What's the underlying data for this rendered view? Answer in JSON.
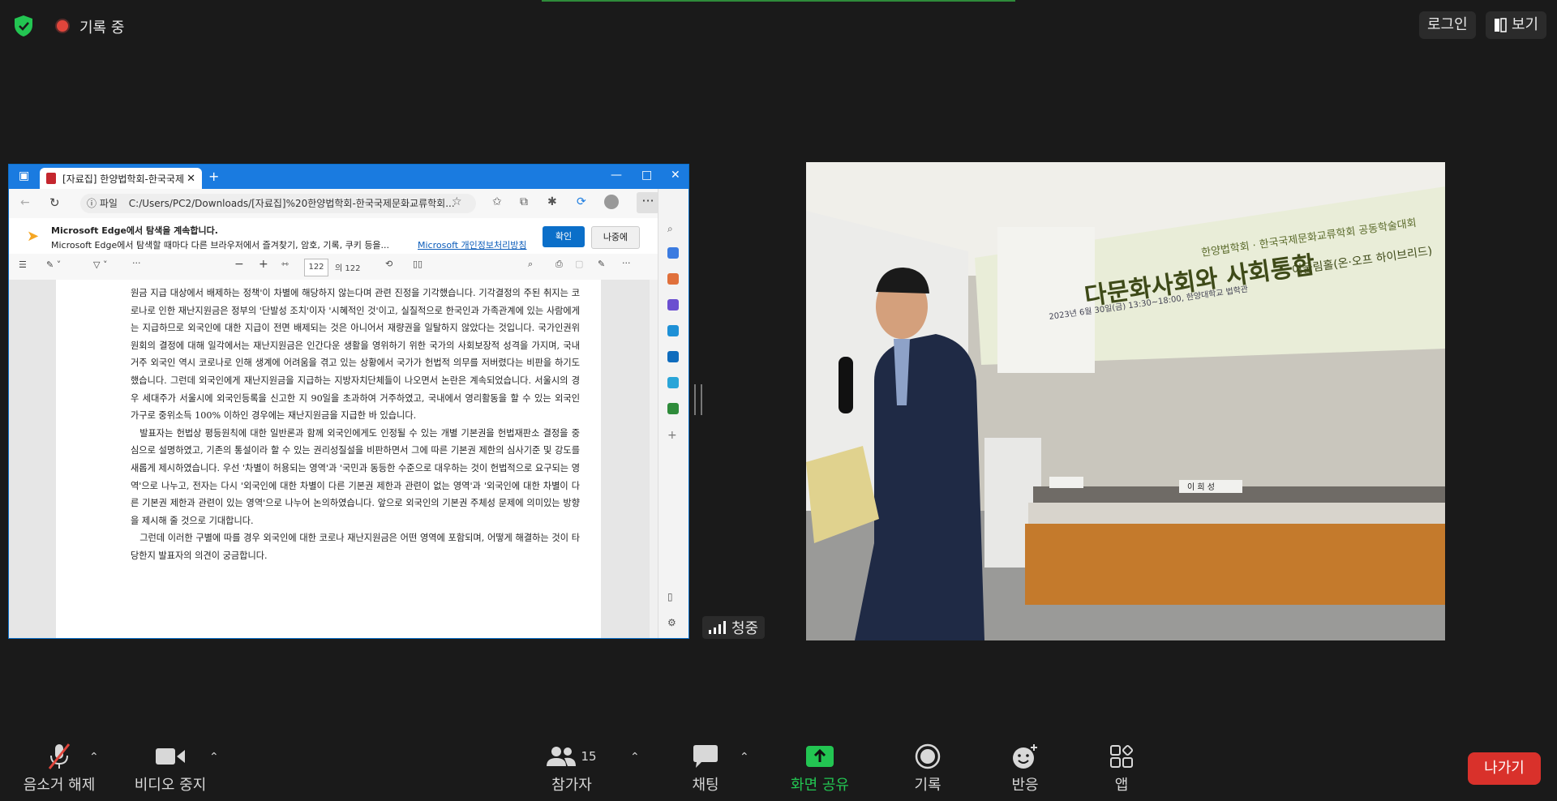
{
  "topbar": {
    "recording_label": "기록 중",
    "login_label": "로그인",
    "view_label": "보기"
  },
  "shared_screen": {
    "browser": {
      "tab_title": "[자료집] 한양법학회-한국국제",
      "tab_new": "+",
      "url_prefix": "파일",
      "url": "C:/Users/PC2/Downloads/[자료집]%20한양법학회-한국국제문화교류학회...",
      "window_controls": [
        "—",
        "□",
        "✕"
      ]
    },
    "infobar": {
      "title": "Microsoft Edge에서 탐색을 계속합니다.",
      "message": "Microsoft Edge에서 탐색할 때마다 다른 브라우저에서 즐겨찾기, 암호, 기록, 쿠키 등을...",
      "link": "Microsoft 개인정보처리방침",
      "ok": "확인",
      "later": "나중에"
    },
    "pdf_toolbar": {
      "page_current": "122",
      "page_total": "의 122"
    },
    "pdf_paragraphs": [
      "원금 지급 대상에서 배제하는 정책'이 차별에 해당하지 않는다며 관련 진정을 기각했습니다. 기각결정의 주된 취지는 코로나로 인한 재난지원금은 정부의 '단발성 조치'이자 '시혜적인 것'이고, 실질적으로 한국인과 가족관계에 있는 사람에게는 지급하므로 외국인에 대한 지급이 전면 배제되는 것은 아니어서 재량권을 일탈하지 않았다는 것입니다. 국가인권위원회의 결정에 대해 일각에서는 재난지원금은 인간다운 생활을 영위하기 위한 국가의 사회보장적 성격을 가지며, 국내 거주 외국인 역시 코로나로 인해 생계에 어려움을 겪고 있는 상황에서 국가가 헌법적 의무를 저버렸다는 비판을 하기도 했습니다. 그런데 외국인에게 재난지원금을 지급하는 지방자치단체들이 나오면서 논란은 계속되었습니다. 서울시의 경우 세대주가 서울시에 외국인등록을 신고한 지 90일을 초과하여 거주하였고, 국내에서 영리활동을 할 수 있는 외국인 가구로 중위소득 100% 이하인 경우에는 재난지원금을 지급한 바 있습니다.",
      "발표자는 헌법상 평등원칙에 대한 일반론과 함께 외국인에게도 인정될 수 있는 개별 기본권을 헌법재판소 결정을 중심으로 설명하였고, 기존의 통설이라 할 수 있는 권리성질설을 비판하면서 그에 따른 기본권 제한의 심사기준 및 강도를 새롭게 제시하였습니다. 우선 '차별이 허용되는 영역'과 '국민과 동등한 수준으로 대우하는 것이 헌법적으로 요구되는 영역'으로 나누고, 전자는 다시 '외국인에 대한 차별이 다른 기본권 제한과 관련이 없는 영역'과 '외국인에 대한 차별이 다른 기본권 제한과 관련이 있는 영역'으로 나누어 논의하였습니다. 앞으로 외국인의 기본권 주체성 문제에 의미있는 방향을 제시해 줄 것으로 기대합니다.",
      "그런데 이러한 구별에 따를 경우 외국인에 대한 코로나 재난지원금은 어떤 영역에 포함되며, 어떻게 해결하는 것이 타당한지 발표자의 의견이 궁금합니다."
    ]
  },
  "listen_label": "청중",
  "video": {
    "banner_top": "한양법학회 · 한국국제문화교류학회 공동학술대회",
    "banner_title": "다문화사회와 사회통합",
    "banner_sub": "어울림홀(온·오프 하이브리드)",
    "banner_date": "2023년 6월 30일(금) 13:30~18:00, 한양대학교 법학관",
    "nameplate": "이 희 성"
  },
  "controls": {
    "mute": "음소거 해제",
    "video": "비디오 중지",
    "participants": "참가자",
    "participants_count": "15",
    "chat": "채팅",
    "share": "화면 공유",
    "record": "기록",
    "reactions": "반응",
    "apps": "앱",
    "leave": "나가기"
  },
  "colors": {
    "background": "#1a1a1a",
    "share_green": "#23c552",
    "leave_red": "#d9312b",
    "edge_blue": "#1a7be0"
  }
}
